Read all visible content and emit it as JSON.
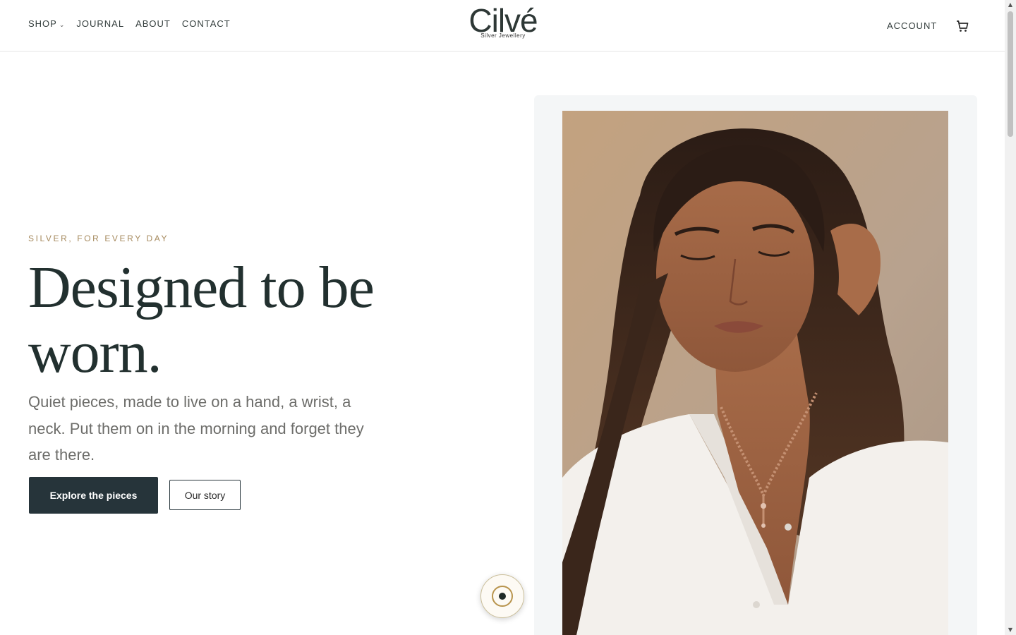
{
  "header": {
    "nav": [
      {
        "label": "SHOP",
        "has_dropdown": true
      },
      {
        "label": "JOURNAL"
      },
      {
        "label": "ABOUT"
      },
      {
        "label": "CONTACT"
      }
    ],
    "logo": {
      "wordmark": "Cilvé",
      "tagline": "Silver Jewellery"
    },
    "account_label": "ACCOUNT",
    "cart_icon": "cart-icon"
  },
  "hero": {
    "eyebrow": "SILVER, FOR EVERY DAY",
    "headline": "Designed to be worn.",
    "lede": "Quiet pieces, made to live on a hand, a wrist, a neck. Put them on in the morning and forget they are there.",
    "primary_cta": "Explore the pieces",
    "secondary_cta": "Our story"
  },
  "colors": {
    "accent": "#a68a5e",
    "primary_button": "#26343a",
    "text": "#22302f",
    "panel_bg": "#f4f6f7"
  }
}
